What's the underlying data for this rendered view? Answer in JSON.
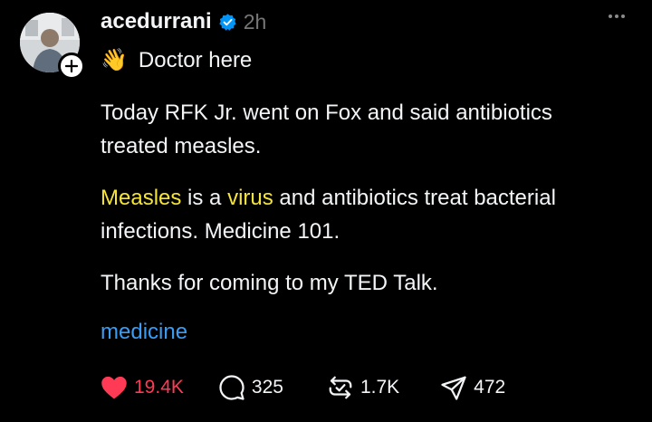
{
  "post": {
    "username": "acedurrani",
    "time": "2h",
    "subtitle_emoji": "👋",
    "subtitle": "Doctor here",
    "paragraph1": "Today RFK Jr. went on Fox and said antibiotics treated measles.",
    "paragraph2_parts": {
      "word1": "Measles",
      "text1": " is a ",
      "word2": "virus",
      "text2": " and antibiotics treat bacterial infections. Medicine 101."
    },
    "paragraph3": "Thanks for coming to my TED Talk.",
    "topic": "medicine"
  },
  "actions": {
    "likes": "19.4K",
    "replies": "325",
    "reposts": "1.7K",
    "shares": "472"
  },
  "colors": {
    "background": "#000000",
    "text": "#f3f5f7",
    "muted": "#777777",
    "highlight": "#f5e43a",
    "topic": "#3b9cf2",
    "like": "#ff3a55",
    "verified": "#0095f6"
  },
  "icons": [
    "avatar",
    "follow-plus-icon",
    "verified-badge-icon",
    "more-options-icon",
    "heart-icon",
    "reply-icon",
    "repost-icon",
    "share-icon"
  ]
}
